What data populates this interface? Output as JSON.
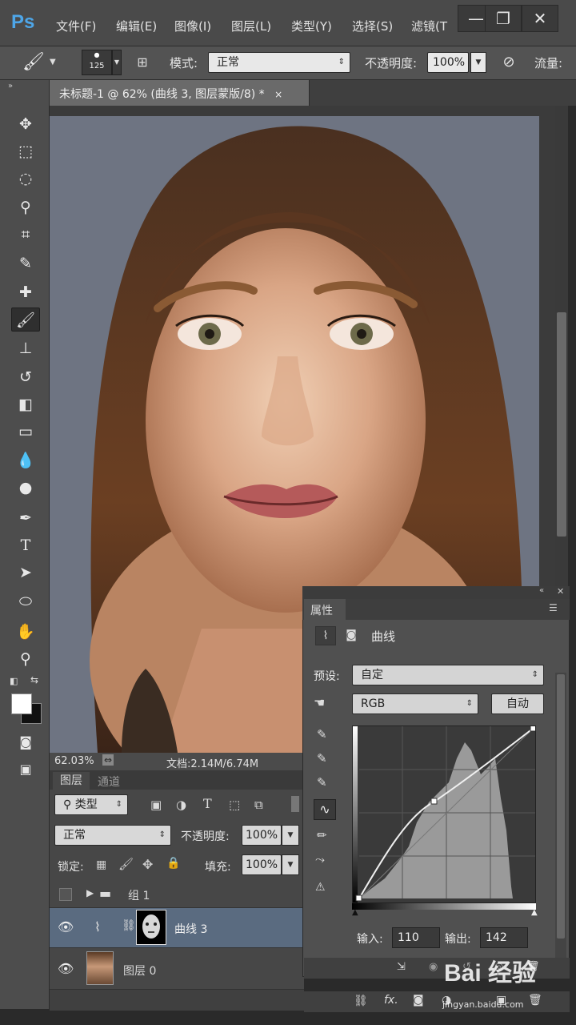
{
  "app": {
    "logo": "Ps",
    "menu": [
      "文件(F)",
      "编辑(E)",
      "图像(I)",
      "图层(L)",
      "类型(Y)",
      "选择(S)",
      "滤镜(T"
    ],
    "window_buttons": [
      "—",
      "❐",
      "✕"
    ]
  },
  "options_bar": {
    "brush_size": "125",
    "mode_label": "模式:",
    "mode_value": "正常",
    "opacity_label": "不透明度:",
    "opacity_value": "100%",
    "flow_label": "流量:"
  },
  "document": {
    "tab_title": "未标题-1 @ 62% (曲线 3, 图层蒙版/8) *",
    "close": "×",
    "zoom": "62.03%",
    "doc_info": "文档:2.14M/6.74M"
  },
  "layers_panel": {
    "tabs": [
      "图层",
      "通道"
    ],
    "filter_label": "类型",
    "blend_mode": "正常",
    "opacity_label": "不透明度:",
    "opacity_value": "100%",
    "lock_label": "锁定:",
    "fill_label": "填充:",
    "fill_value": "100%",
    "layers": [
      {
        "name": "组 1",
        "type": "group"
      },
      {
        "name": "曲线 3",
        "type": "adjustment"
      },
      {
        "name": "图层 0",
        "type": "image"
      }
    ]
  },
  "properties_panel": {
    "tab": "属性",
    "title": "曲线",
    "preset_label": "预设:",
    "preset_value": "自定",
    "channel_value": "RGB",
    "auto_button": "自动",
    "input_label": "输入:",
    "input_value": "110",
    "output_label": "输出:",
    "output_value": "142"
  },
  "watermark": {
    "text": "Bai 经验",
    "url": "jingyan.baidu.com"
  },
  "colors": {
    "accent": "#4ea6e8",
    "panel_bg": "#505050",
    "layer_selected": "#5a6b80"
  }
}
